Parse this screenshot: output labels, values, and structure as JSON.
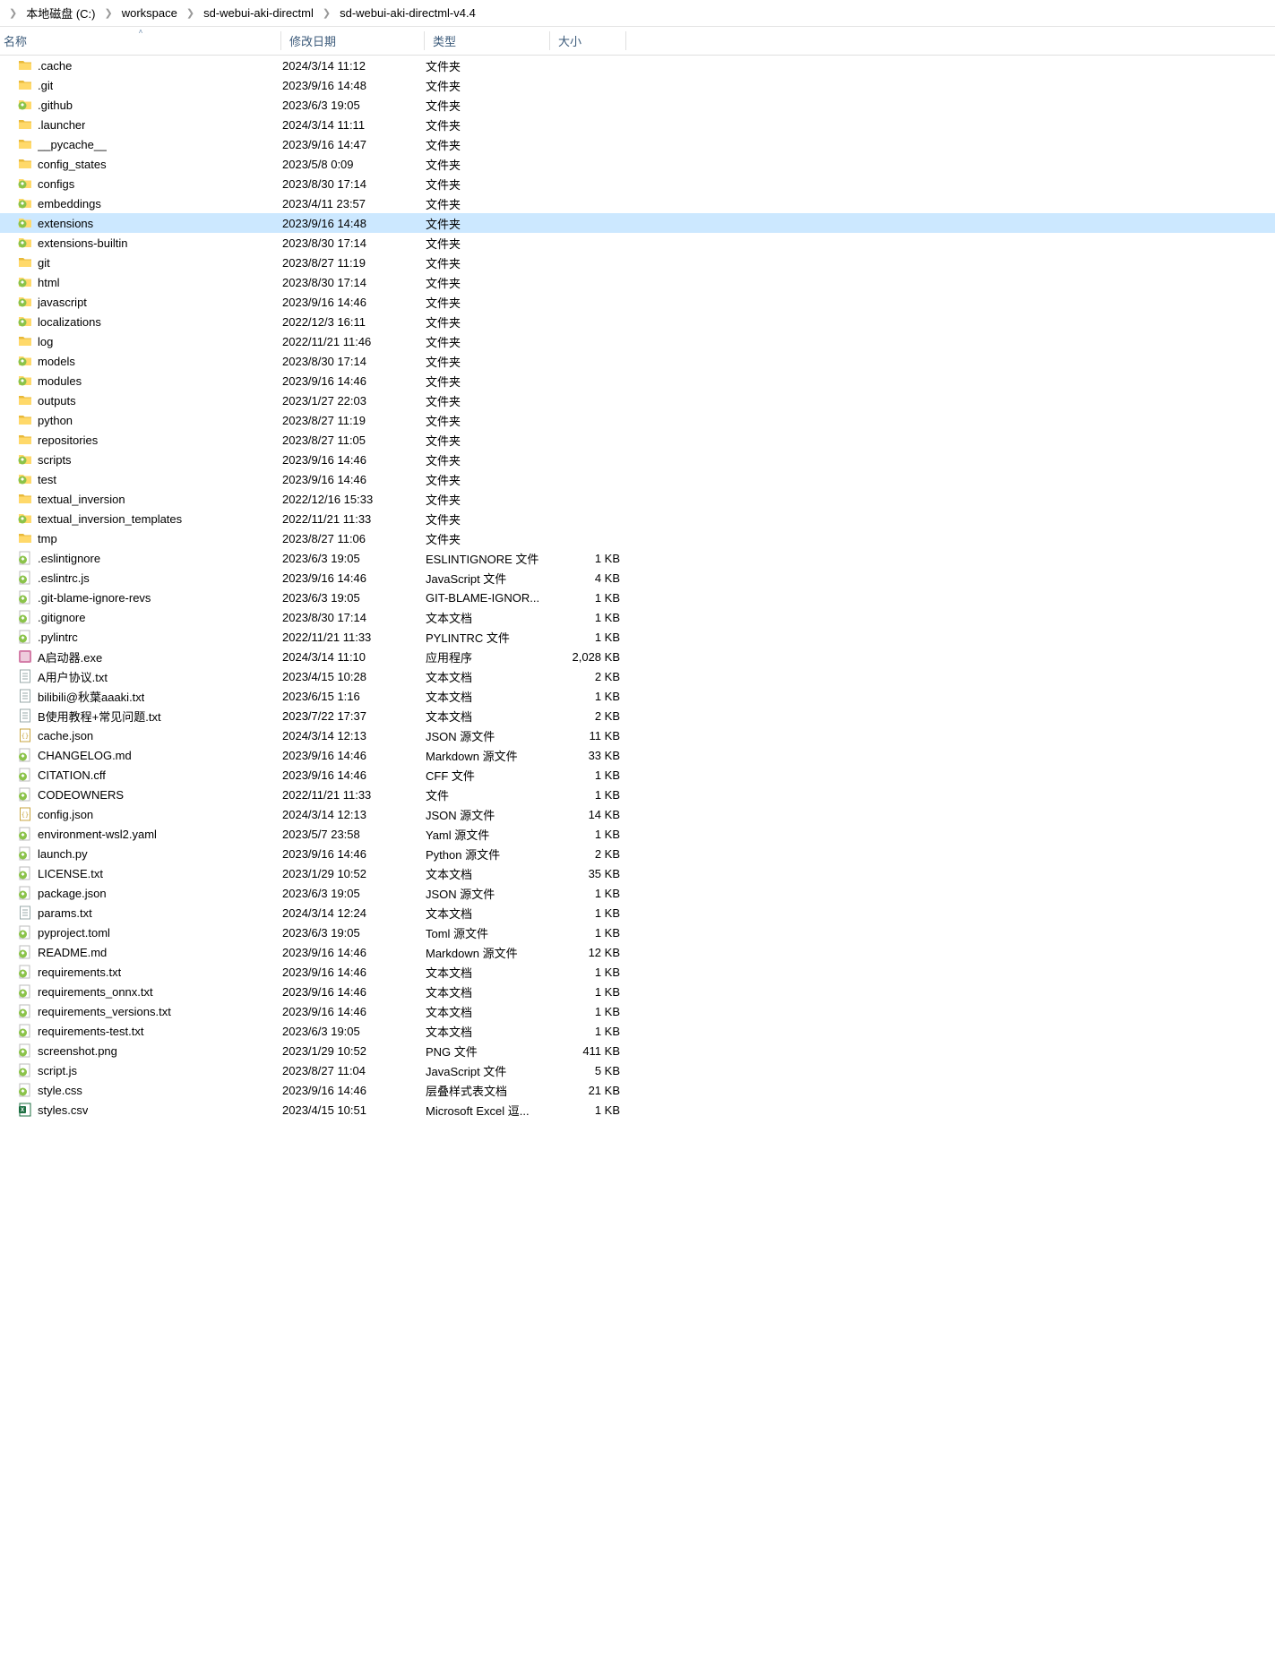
{
  "breadcrumb": [
    "本地磁盘 (C:)",
    "workspace",
    "sd-webui-aki-directml",
    "sd-webui-aki-directml-v4.4"
  ],
  "headers": {
    "name": "名称",
    "date": "修改日期",
    "type": "类型",
    "size": "大小"
  },
  "selectedIndex": 8,
  "rows": [
    {
      "icon": "folder",
      "name": ".cache",
      "date": "2024/3/14 11:12",
      "type": "文件夹",
      "size": ""
    },
    {
      "icon": "folder",
      "name": ".git",
      "date": "2023/9/16 14:48",
      "type": "文件夹",
      "size": ""
    },
    {
      "icon": "git",
      "name": ".github",
      "date": "2023/6/3 19:05",
      "type": "文件夹",
      "size": ""
    },
    {
      "icon": "folder",
      "name": ".launcher",
      "date": "2024/3/14 11:11",
      "type": "文件夹",
      "size": ""
    },
    {
      "icon": "folder",
      "name": "__pycache__",
      "date": "2023/9/16 14:47",
      "type": "文件夹",
      "size": ""
    },
    {
      "icon": "folder",
      "name": "config_states",
      "date": "2023/5/8 0:09",
      "type": "文件夹",
      "size": ""
    },
    {
      "icon": "git",
      "name": "configs",
      "date": "2023/8/30 17:14",
      "type": "文件夹",
      "size": ""
    },
    {
      "icon": "git",
      "name": "embeddings",
      "date": "2023/4/11 23:57",
      "type": "文件夹",
      "size": ""
    },
    {
      "icon": "git",
      "name": "extensions",
      "date": "2023/9/16 14:48",
      "type": "文件夹",
      "size": ""
    },
    {
      "icon": "git",
      "name": "extensions-builtin",
      "date": "2023/8/30 17:14",
      "type": "文件夹",
      "size": ""
    },
    {
      "icon": "folder",
      "name": "git",
      "date": "2023/8/27 11:19",
      "type": "文件夹",
      "size": ""
    },
    {
      "icon": "git",
      "name": "html",
      "date": "2023/8/30 17:14",
      "type": "文件夹",
      "size": ""
    },
    {
      "icon": "git",
      "name": "javascript",
      "date": "2023/9/16 14:46",
      "type": "文件夹",
      "size": ""
    },
    {
      "icon": "git",
      "name": "localizations",
      "date": "2022/12/3 16:11",
      "type": "文件夹",
      "size": ""
    },
    {
      "icon": "folder",
      "name": "log",
      "date": "2022/11/21 11:46",
      "type": "文件夹",
      "size": ""
    },
    {
      "icon": "git",
      "name": "models",
      "date": "2023/8/30 17:14",
      "type": "文件夹",
      "size": ""
    },
    {
      "icon": "git",
      "name": "modules",
      "date": "2023/9/16 14:46",
      "type": "文件夹",
      "size": ""
    },
    {
      "icon": "folder",
      "name": "outputs",
      "date": "2023/1/27 22:03",
      "type": "文件夹",
      "size": ""
    },
    {
      "icon": "folder",
      "name": "python",
      "date": "2023/8/27 11:19",
      "type": "文件夹",
      "size": ""
    },
    {
      "icon": "folder",
      "name": "repositories",
      "date": "2023/8/27 11:05",
      "type": "文件夹",
      "size": ""
    },
    {
      "icon": "git",
      "name": "scripts",
      "date": "2023/9/16 14:46",
      "type": "文件夹",
      "size": ""
    },
    {
      "icon": "git",
      "name": "test",
      "date": "2023/9/16 14:46",
      "type": "文件夹",
      "size": ""
    },
    {
      "icon": "folder",
      "name": "textual_inversion",
      "date": "2022/12/16 15:33",
      "type": "文件夹",
      "size": ""
    },
    {
      "icon": "git",
      "name": "textual_inversion_templates",
      "date": "2022/11/21 11:33",
      "type": "文件夹",
      "size": ""
    },
    {
      "icon": "folder",
      "name": "tmp",
      "date": "2023/8/27 11:06",
      "type": "文件夹",
      "size": ""
    },
    {
      "icon": "gitfile",
      "name": ".eslintignore",
      "date": "2023/6/3 19:05",
      "type": "ESLINTIGNORE 文件",
      "size": "1 KB"
    },
    {
      "icon": "gitfile",
      "name": ".eslintrc.js",
      "date": "2023/9/16 14:46",
      "type": "JavaScript 文件",
      "size": "4 KB"
    },
    {
      "icon": "gitfile",
      "name": ".git-blame-ignore-revs",
      "date": "2023/6/3 19:05",
      "type": "GIT-BLAME-IGNOR...",
      "size": "1 KB"
    },
    {
      "icon": "gitfile",
      "name": ".gitignore",
      "date": "2023/8/30 17:14",
      "type": "文本文档",
      "size": "1 KB"
    },
    {
      "icon": "gitfile",
      "name": ".pylintrc",
      "date": "2022/11/21 11:33",
      "type": "PYLINTRC 文件",
      "size": "1 KB"
    },
    {
      "icon": "exe",
      "name": "A启动器.exe",
      "date": "2024/3/14 11:10",
      "type": "应用程序",
      "size": "2,028 KB"
    },
    {
      "icon": "txt",
      "name": "A用户协议.txt",
      "date": "2023/4/15 10:28",
      "type": "文本文档",
      "size": "2 KB"
    },
    {
      "icon": "txt",
      "name": "bilibili@秋葉aaaki.txt",
      "date": "2023/6/15 1:16",
      "type": "文本文档",
      "size": "1 KB"
    },
    {
      "icon": "txt",
      "name": "B使用教程+常见问题.txt",
      "date": "2023/7/22 17:37",
      "type": "文本文档",
      "size": "2 KB"
    },
    {
      "icon": "json",
      "name": "cache.json",
      "date": "2024/3/14 12:13",
      "type": "JSON 源文件",
      "size": "11 KB"
    },
    {
      "icon": "gitfile",
      "name": "CHANGELOG.md",
      "date": "2023/9/16 14:46",
      "type": "Markdown 源文件",
      "size": "33 KB"
    },
    {
      "icon": "gitfile",
      "name": "CITATION.cff",
      "date": "2023/9/16 14:46",
      "type": "CFF 文件",
      "size": "1 KB"
    },
    {
      "icon": "gitfile",
      "name": "CODEOWNERS",
      "date": "2022/11/21 11:33",
      "type": "文件",
      "size": "1 KB"
    },
    {
      "icon": "json",
      "name": "config.json",
      "date": "2024/3/14 12:13",
      "type": "JSON 源文件",
      "size": "14 KB"
    },
    {
      "icon": "gitfile",
      "name": "environment-wsl2.yaml",
      "date": "2023/5/7 23:58",
      "type": "Yaml 源文件",
      "size": "1 KB"
    },
    {
      "icon": "gitfile",
      "name": "launch.py",
      "date": "2023/9/16 14:46",
      "type": "Python 源文件",
      "size": "2 KB"
    },
    {
      "icon": "gitfile",
      "name": "LICENSE.txt",
      "date": "2023/1/29 10:52",
      "type": "文本文档",
      "size": "35 KB"
    },
    {
      "icon": "gitfile",
      "name": "package.json",
      "date": "2023/6/3 19:05",
      "type": "JSON 源文件",
      "size": "1 KB"
    },
    {
      "icon": "txt",
      "name": "params.txt",
      "date": "2024/3/14 12:24",
      "type": "文本文档",
      "size": "1 KB"
    },
    {
      "icon": "gitfile",
      "name": "pyproject.toml",
      "date": "2023/6/3 19:05",
      "type": "Toml 源文件",
      "size": "1 KB"
    },
    {
      "icon": "gitfile",
      "name": "README.md",
      "date": "2023/9/16 14:46",
      "type": "Markdown 源文件",
      "size": "12 KB"
    },
    {
      "icon": "gitfile",
      "name": "requirements.txt",
      "date": "2023/9/16 14:46",
      "type": "文本文档",
      "size": "1 KB"
    },
    {
      "icon": "gitfile",
      "name": "requirements_onnx.txt",
      "date": "2023/9/16 14:46",
      "type": "文本文档",
      "size": "1 KB"
    },
    {
      "icon": "gitfile",
      "name": "requirements_versions.txt",
      "date": "2023/9/16 14:46",
      "type": "文本文档",
      "size": "1 KB"
    },
    {
      "icon": "gitfile",
      "name": "requirements-test.txt",
      "date": "2023/6/3 19:05",
      "type": "文本文档",
      "size": "1 KB"
    },
    {
      "icon": "gitfile",
      "name": "screenshot.png",
      "date": "2023/1/29 10:52",
      "type": "PNG 文件",
      "size": "411 KB"
    },
    {
      "icon": "gitfile",
      "name": "script.js",
      "date": "2023/8/27 11:04",
      "type": "JavaScript 文件",
      "size": "5 KB"
    },
    {
      "icon": "gitfile",
      "name": "style.css",
      "date": "2023/9/16 14:46",
      "type": "层叠样式表文档",
      "size": "21 KB"
    },
    {
      "icon": "excel",
      "name": "styles.csv",
      "date": "2023/4/15 10:51",
      "type": "Microsoft Excel 逗...",
      "size": "1 KB"
    }
  ]
}
